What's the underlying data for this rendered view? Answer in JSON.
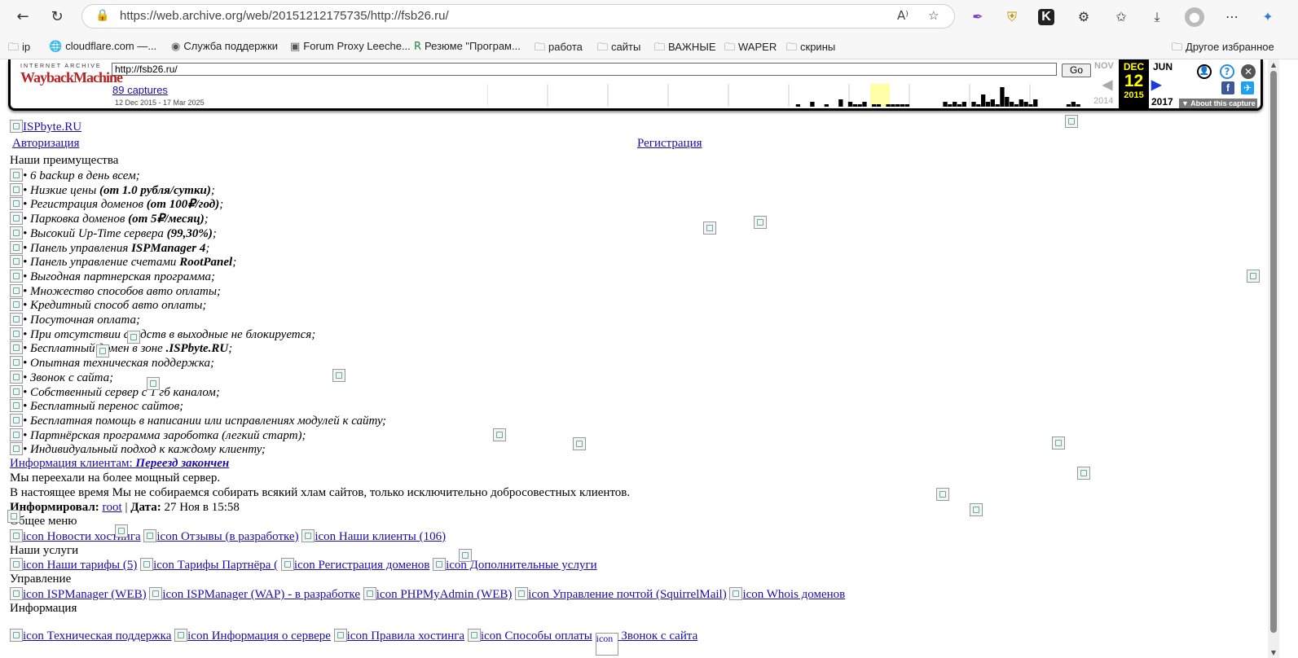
{
  "browser": {
    "url": "https://web.archive.org/web/20151212175735/http://fsb26.ru/",
    "bookmarks": [
      "ip",
      "cloudflare.com —...",
      "Служба поддержки",
      "Forum Proxy Leeche...",
      "Резюме \"Програм...",
      "работа",
      "сайты",
      "ВАЖНЫЕ",
      "WAPER",
      "скрины"
    ],
    "other_bookmarks": "Другое избранное"
  },
  "wayback": {
    "logo_top": "INTERNET ARCHIVE",
    "logo_main": "WaybackMachine",
    "input_value": "http://fsb26.ru/",
    "go_label": "Go",
    "captures": "89 captures",
    "range": "12 Dec 2015 - 17 Mar 2025",
    "prev_month": "NOV",
    "prev_year": "2014",
    "cur_month": "DEC",
    "cur_day": "12",
    "cur_year": "2015",
    "next_month": "JUN",
    "next_year": "2017",
    "about": "About this capture",
    "sparkline": [
      0,
      0,
      0,
      0,
      0,
      0,
      0,
      0,
      0,
      0,
      0,
      0,
      0,
      0,
      0,
      0,
      0,
      0,
      0,
      0,
      0,
      0,
      0,
      0,
      0,
      0,
      0,
      0,
      0,
      0,
      0,
      0,
      0,
      0,
      0,
      0,
      0,
      0,
      0,
      0,
      0,
      0,
      0,
      0,
      0,
      0,
      0,
      0,
      0,
      0,
      0,
      0,
      0,
      0,
      0,
      0,
      0,
      0,
      0,
      0,
      0,
      0,
      0,
      0,
      0,
      1,
      0,
      0,
      2,
      0,
      0,
      1,
      0,
      0,
      3,
      0,
      2,
      1,
      1,
      2,
      0,
      1,
      1,
      0,
      1,
      1,
      1,
      1,
      1,
      0,
      0,
      0,
      0,
      0,
      0,
      0,
      2,
      1,
      2,
      1,
      2,
      0,
      2,
      1,
      5,
      2,
      3,
      1,
      8,
      4,
      2,
      1,
      3,
      2,
      1,
      3,
      0,
      0,
      0,
      0,
      0,
      0,
      1,
      2,
      1,
      0,
      0
    ]
  },
  "page": {
    "logo_alt": "ISPbyte.RU",
    "login": "Авторизация",
    "register": "Регистрация",
    "advantages_title": "Наши преимущества",
    "advantages": [
      {
        "text": "• 6 backup в день всем;",
        "bold": ""
      },
      {
        "text": "• Низкие цены ",
        "bold": "(от 1.0 рубля/сутки)",
        "tail": ";"
      },
      {
        "text": "• Регистрация доменов ",
        "bold": "(от 100₽/год)",
        "tail": ";"
      },
      {
        "text": "• Парковка доменов ",
        "bold": "(от 5₽/месяц)",
        "tail": ";"
      },
      {
        "text": "• Высокий Up-Time сервера ",
        "bold": "(99,30%)",
        "tail": ";"
      },
      {
        "text": "• Панель управления ",
        "bold": "ISPManager 4",
        "tail": ";"
      },
      {
        "text": "• Панель управление счетами ",
        "bold": "RootPanel",
        "tail": ";"
      },
      {
        "text": "• Выгодная партнерская программа;",
        "bold": ""
      },
      {
        "text": "• Множество способов авто оплаты;",
        "bold": ""
      },
      {
        "text": "• Кредитный способ авто оплаты;",
        "bold": ""
      },
      {
        "text": "• Посуточная оплата;",
        "bold": ""
      },
      {
        "text": "• При отсутствии средств в выходные не блокируется;",
        "bold": ""
      },
      {
        "text": "• Бесплатный домен в зоне ",
        "bold": ".ISPbyte.RU",
        "tail": ";"
      },
      {
        "text": "• Опытная техническая поддержка;",
        "bold": ""
      },
      {
        "text": "• Звонок с сайта;",
        "bold": ""
      },
      {
        "text": "• Собственный сервер с 1 гб каналом;",
        "bold": ""
      },
      {
        "text": "• Бесплатный перенос сайтов;",
        "bold": ""
      },
      {
        "text": "• Бесплатная помощь в написании или исправлениях модулей к сайту;",
        "bold": ""
      },
      {
        "text": "• Партнёрская программа зароботка (легкий старт);",
        "bold": ""
      },
      {
        "text": "• Индивидуальный подход к каждому клиенту;",
        "bold": ""
      }
    ],
    "info_link": "Информация клиентам: ",
    "info_link_bold": "Переезд закончен",
    "info_line1": "Мы переехали на более мощный сервер.",
    "info_line2": "В настоящее время Мы не собираемся собирать всякий хлам сайтов, только исключительно добросовестных клиентов.",
    "informed_label": "Информировал:",
    "informed_user": "root",
    "date_label": "Дата:",
    "date_value": "27 Ноя в 15:58",
    "menu_title": "Общее меню",
    "menu_items": [
      "icon Новости хостинга",
      "icon Отзывы (в разработке)",
      "icon Наши клиенты (106)"
    ],
    "services_title": "Наши услуги",
    "services_items": [
      "icon Наши тарифы (5)",
      "icon Тарифы Партнёра (",
      "icon Регистрация доменов",
      "icon Дополнительные услуги"
    ],
    "control_title": "Управление",
    "control_items": [
      "icon ISPManager (WEB)",
      "icon ISPManager (WAP) - в разработке",
      "icon PHPMyAdmin (WEB)",
      "icon Управление почтой (SquirrelMail)",
      "icon Whois доменов"
    ],
    "infoblock_title": "Информация",
    "infoblock_items": [
      "icon Техническая поддержка",
      "icon Информация о сервере",
      "icon Правила хостинга",
      "icon Способы оплаты",
      "icon",
      "Звонок с сайта"
    ]
  }
}
